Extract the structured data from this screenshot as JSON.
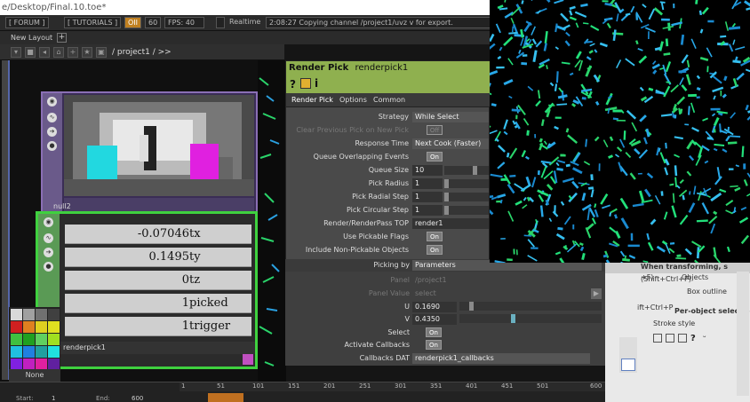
{
  "window": {
    "title": "e/Desktop/Final.10.toe*"
  },
  "menubar": {
    "forum": "[ FORUM ]",
    "tutorials": "[ TUTORIALS ]",
    "oii": "OII",
    "fps_box": "60",
    "fps": "FPS: 40",
    "realtime": "Realtime",
    "status": "2:08:27 Copying channel /project1/uvz v for export."
  },
  "layout": {
    "tab": "New Layout"
  },
  "path": {
    "crumb": "/ project1 / >>"
  },
  "nodes": {
    "null_name": "null2",
    "pick_name": "renderpick1"
  },
  "channels": [
    {
      "value": "-0.07046",
      "name": "tx"
    },
    {
      "value": "0.1495",
      "name": "ty"
    },
    {
      "value": "0",
      "name": "tz"
    },
    {
      "value": "1",
      "name": "picked"
    },
    {
      "value": "1",
      "name": "trigger"
    }
  ],
  "palette": {
    "none": "None",
    "colors": [
      "#d9d9d9",
      "#a0a0a0",
      "#707070",
      "#404040",
      "#d02020",
      "#e08020",
      "#e0d020",
      "#e0e020",
      "#40c040",
      "#20a020",
      "#60d060",
      "#a0e020",
      "#20c0e0",
      "#2080e0",
      "#20a0a0",
      "#20e0e0",
      "#8020e0",
      "#c020c0",
      "#e020a0",
      "#6020a0"
    ]
  },
  "params": {
    "op_type": "Render Pick",
    "op_name": "renderpick1",
    "tabs": [
      "Render Pick",
      "Options",
      "Common"
    ],
    "rows": [
      {
        "label": "Strategy",
        "value": "While Select"
      },
      {
        "label": "Clear Previous Pick on New Pick",
        "value": "Off"
      },
      {
        "label": "Response Time",
        "value": "Next Cook (Faster)"
      },
      {
        "label": "Queue Overlapping Events",
        "value": "On"
      },
      {
        "label": "Queue Size",
        "value": "10"
      },
      {
        "label": "Pick Radius",
        "value": "1"
      },
      {
        "label": "Pick Radial Step",
        "value": "1"
      },
      {
        "label": "Pick Circular Step",
        "value": "1"
      },
      {
        "label": "Render/RenderPass TOP",
        "value": "render1"
      },
      {
        "label": "Use Pickable Flags",
        "value": "On"
      },
      {
        "label": "Include Non-Pickable Objects",
        "value": "On"
      },
      {
        "label": "Picking by",
        "value": "Parameters"
      },
      {
        "label": "Panel",
        "value": "/project1"
      },
      {
        "label": "Panel Value",
        "value": "select"
      },
      {
        "label": "U",
        "value": "0.1690"
      },
      {
        "label": "V",
        "value": "0.4350"
      },
      {
        "label": "Select",
        "value": "On"
      },
      {
        "label": "Activate Callbacks",
        "value": "On"
      },
      {
        "label": "Callbacks DAT",
        "value": "renderpick1_callbacks"
      }
    ]
  },
  "right": {
    "when": "When transforming, s",
    "shift1": "(Shift+Ctrl+P)",
    "objects": "Objects",
    "box": "Box outline",
    "shift2": "ift+Ctrl+P",
    "perobj": "Per-object selection",
    "stroke": "Stroke style",
    "p": "+F)"
  },
  "timeline": {
    "start_label": "Start:",
    "start": "1",
    "end_label": "End:",
    "end": "600",
    "ticks": [
      "1",
      "51",
      "101",
      "151",
      "201",
      "251",
      "301",
      "351",
      "401",
      "451",
      "501",
      "600"
    ]
  }
}
